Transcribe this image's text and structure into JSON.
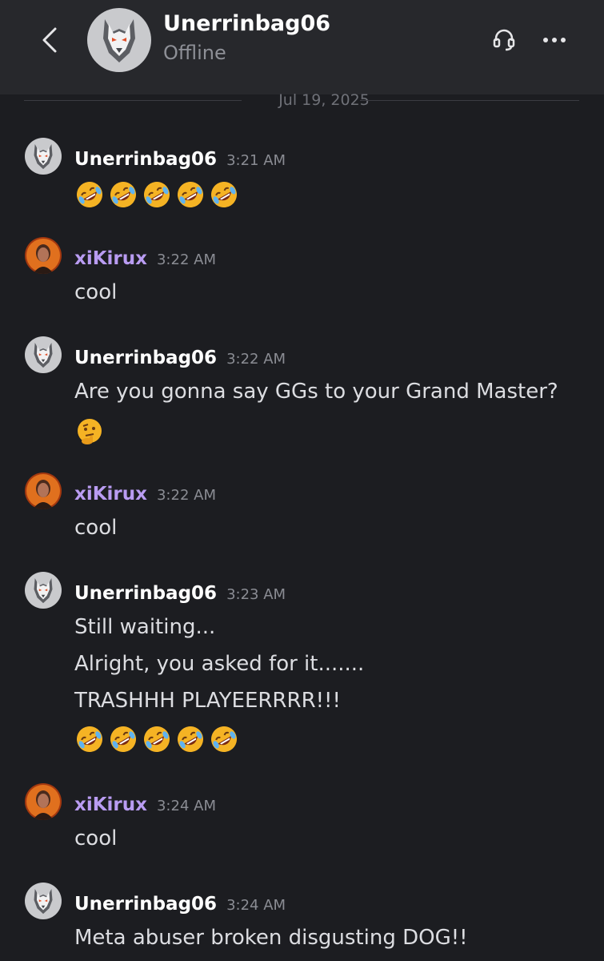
{
  "header": {
    "contact_name": "Unerrinbag06",
    "status": "Offline"
  },
  "date_divider": "Jul 19, 2025",
  "messages": [
    {
      "author": "Unerrinbag06",
      "time": "3:21 AM",
      "lines": [],
      "emoji_rows": [
        {
          "emoji": "rolling-on-floor-laughing",
          "count": 5
        }
      ]
    },
    {
      "author": "xiKirux",
      "time": "3:22 AM",
      "lines": [
        "cool"
      ]
    },
    {
      "author": "Unerrinbag06",
      "time": "3:22 AM",
      "lines": [
        "Are you gonna say GGs to your Grand Master?"
      ],
      "emoji_rows": [
        {
          "emoji": "thinking-face",
          "count": 1
        }
      ]
    },
    {
      "author": "xiKirux",
      "time": "3:22 AM",
      "lines": [
        "cool"
      ]
    },
    {
      "author": "Unerrinbag06",
      "time": "3:23 AM",
      "lines": [
        "Still waiting...",
        "Alright, you asked for it.......",
        "TRASHHH PLAYEERRRR!!!"
      ],
      "emoji_rows": [
        {
          "emoji": "rolling-on-floor-laughing",
          "count": 5
        }
      ]
    },
    {
      "author": "xiKirux",
      "time": "3:24 AM",
      "lines": [
        "cool"
      ]
    },
    {
      "author": "Unerrinbag06",
      "time": "3:24 AM",
      "lines": [
        "Meta abuser broken disgusting DOG!!"
      ]
    }
  ],
  "colors": {
    "background": "#1c1d21",
    "header": "#27282c",
    "username_friend": "#b99cf2",
    "username_contact": "#ffffff"
  },
  "icons": [
    "back-arrow-icon",
    "headset-icon",
    "more-options-icon",
    "wolf-avatar",
    "user-avatar"
  ]
}
